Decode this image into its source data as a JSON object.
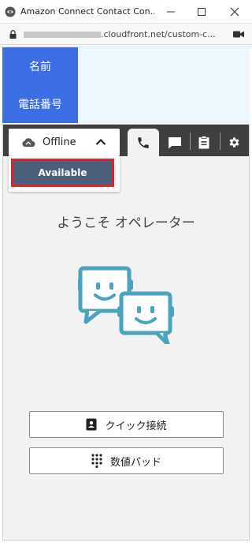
{
  "window": {
    "title": "Amazon Connect Contact Con...",
    "url_visible": ".cloudfront.net/custom-c..."
  },
  "form": {
    "name_label": "名前",
    "phone_label": "電話番号"
  },
  "ccp": {
    "status": "Offline",
    "status_options": [
      "Available"
    ],
    "welcome": "ようこそ オペレーター",
    "quick_connect": "クイック接続",
    "number_pad": "数値パッド"
  },
  "colors": {
    "label_blue": "#3b6ee3",
    "field_bg": "#ecf7ff",
    "top_bar": "#3f3f3f",
    "option_bg": "#4b5f7c",
    "highlight_red": "#e0222e",
    "graphic_teal": "#4aa3bf"
  }
}
